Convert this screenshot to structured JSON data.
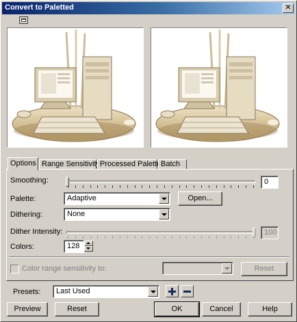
{
  "window": {
    "title": "Convert to Paletted",
    "close_glyph": "✕"
  },
  "tabs": [
    {
      "label": "Options"
    },
    {
      "label": "Range Sensitivity"
    },
    {
      "label": "Processed Palette"
    },
    {
      "label": "Batch"
    }
  ],
  "options": {
    "smoothing": {
      "label": "Smoothing:",
      "value": "0"
    },
    "palette": {
      "label": "Palette:",
      "value": "Adaptive",
      "open_button": "Open..."
    },
    "dithering": {
      "label": "Dithering:",
      "value": "None"
    },
    "dither_intensity": {
      "label": "Dither Intensity:",
      "value": "100"
    },
    "colors": {
      "label": "Colors:",
      "value": "128"
    },
    "color_range": {
      "label": "Color range sensitivity to:",
      "value": "",
      "reset_button": "Reset"
    }
  },
  "presets": {
    "label": "Presets:",
    "value": "Last Used"
  },
  "buttons": {
    "preview": "Preview",
    "reset": "Reset",
    "ok": "OK",
    "cancel": "Cancel",
    "help": "Help"
  },
  "colors": {
    "title_start": "#0a246a",
    "title_end": "#a6caf0",
    "face": "#d4d0c8",
    "preset_icon": "#102a5c"
  },
  "icons": {
    "close": "close-icon",
    "view_toggle": "single-preview-icon",
    "add_preset": "plus-icon",
    "remove_preset": "minus-icon",
    "dropdown": "chevron-down-icon",
    "spin_up": "arrow-up-icon",
    "spin_down": "arrow-down-icon"
  }
}
